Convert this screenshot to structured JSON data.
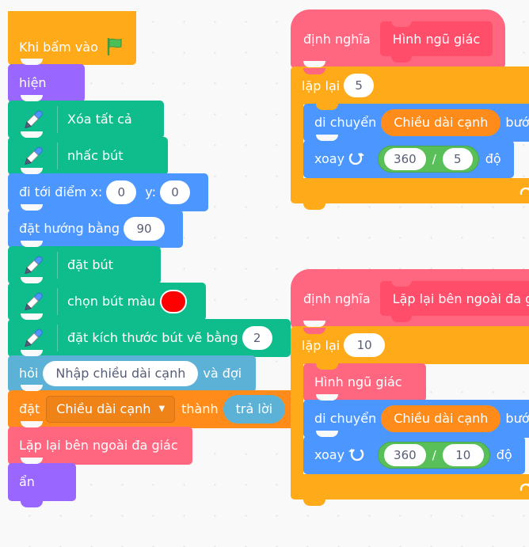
{
  "canvas": {
    "background": "#f9f9f9",
    "grid_dot_color": "#e3e3e3"
  },
  "palette": {
    "events": "#ffab19",
    "looks": "#9966ff",
    "pen": "#0fbd8c",
    "motion": "#4c97ff",
    "sensing": "#5cb1d6",
    "variables": "#ff8c1a",
    "custom": "#ff6680",
    "control": "#ffab19",
    "operators": "#59c059",
    "pen_color_value": "#ff0000"
  },
  "scripts": {
    "main": {
      "hat": {
        "label": "Khi bấm vào",
        "icon": "green-flag-icon"
      },
      "blocks": {
        "show": "hiện",
        "erase_all": "Xóa tất cả",
        "pen_up": "nhấc bút",
        "goto_label": "đi tới điểm x:",
        "goto_x": "0",
        "goto_y_label": "y:",
        "goto_y": "0",
        "point_label": "đặt hướng bằng",
        "point_value": "90",
        "pen_down": "đặt bút",
        "set_pen_color": "chọn bút màu",
        "set_pen_size": "đặt kích thước bút vẽ bằng",
        "pen_size_value": "2",
        "ask_label": "hỏi",
        "ask_value": "Nhập chiều dài cạnh",
        "ask_suffix": "và đợi",
        "set_label": "đặt",
        "set_variable": "Chiều dài cạnh",
        "set_to": "thành",
        "set_value": "trả lời",
        "call_custom": "Lặp lại bên ngoài đa giác",
        "hide": "ẩn"
      }
    },
    "pentagon_def": {
      "define_label": "định nghĩa",
      "proc_name": "Hình ngũ giác",
      "repeat_label": "lặp lại",
      "repeat_value": "5",
      "move_label": "di chuyển",
      "move_arg": "Chiều dài cạnh",
      "move_suffix": "bước",
      "turn_label": "xoay",
      "turn_direction": "clockwise",
      "turn_numerator": "360",
      "turn_denominator": "5",
      "turn_suffix": "độ"
    },
    "outer_loop_def": {
      "define_label": "định nghĩa",
      "proc_name": "Lặp lại bên ngoài đa giác",
      "repeat_label": "lặp lại",
      "repeat_value": "10",
      "call_pentagon": "Hình ngũ giác",
      "move_label": "di chuyển",
      "move_arg": "Chiều dài cạnh",
      "move_suffix": "bước",
      "turn_label": "xoay",
      "turn_direction": "counter-clockwise",
      "turn_numerator": "360",
      "turn_denominator": "10",
      "turn_suffix": "độ"
    }
  }
}
